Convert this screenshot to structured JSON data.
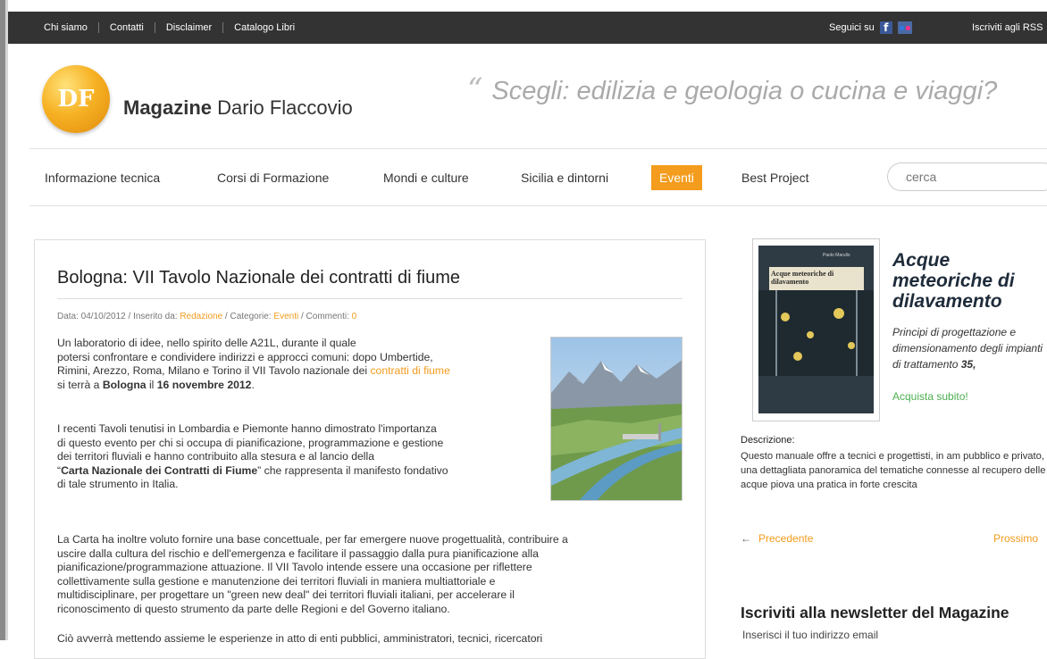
{
  "topbar": {
    "links": [
      "Chi siamo",
      "Contatti",
      "Disclaimer",
      "Catalogo Libri"
    ],
    "follow_label": "Seguici su",
    "rss_label": "Iscriviti agli RSS"
  },
  "header": {
    "logo_text": "DF",
    "title_bold": "Magazine",
    "title_rest": "Dario Flaccovio",
    "tagline": "Scegli: edilizia e geologia o cucina e viaggi?"
  },
  "mainnav": {
    "items": [
      "Informazione tecnica",
      "Corsi di Formazione",
      "Mondi e culture",
      "Sicilia e dintorni",
      "Eventi",
      "Best Project"
    ],
    "active_index": 4,
    "search_placeholder": "cerca"
  },
  "article": {
    "title": "Bologna: VII Tavolo Nazionale dei contratti di fiume",
    "meta": {
      "date_label": "Data: 04/10/2012 / Inserito da:",
      "author": "Redazione",
      "cat_label": "/ Categorie:",
      "category": "Eventi",
      "comments_label": "/ Commenti:",
      "comments": "0"
    },
    "p1": {
      "l1": "Un laboratorio di idee, nello spirito delle A21L, durante il quale",
      "l2": "potersi confrontare e condividere indirizzi e approcci comuni: dopo Umbertide,",
      "l3a": "Rimini, Arezzo, Roma, Milano e Torino il VII Tavolo nazionale dei",
      "l3link": "contratti di fiume",
      "l4a": "si terrà a",
      "l4b": "Bologna",
      "l4c": "il",
      "l4d": "16 novembre 2012",
      "l4e": "."
    },
    "p2": {
      "l1": "I recenti Tavoli tenutisi in Lombardia e Piemonte hanno dimostrato l'importanza",
      "l2": "di questo evento per chi si occupa di pianificazione, programmazione e gestione",
      "l3": "dei territori fluviali e hanno contribuito alla stesura e al lancio della",
      "l4a": "“",
      "l4b": "Carta Nazionale dei Contratti di Fiume",
      "l4c": "” che rappresenta il manifesto fondativo",
      "l5": "di tale strumento in Italia."
    },
    "p3": {
      "l1": "La Carta ha inoltre voluto fornire una base concettuale, per far emergere nuove progettualità, contribuire a",
      "l2": "uscire dalla cultura del rischio e dell'emergenza e facilitare il passaggio dalla pura pianificazione alla",
      "l3": "pianificazione/programmazione attuazione. Il VII Tavolo intende essere una occasione per riflettere",
      "l4": "collettivamente sulla gestione e manutenzione dei territori fluviali in maniera multiattoriale e",
      "l5": "multidisciplinare, per progettare un \"green new deal\" dei territori fluviali italiani, per accelerare il",
      "l6": "riconoscimento di questo strumento da parte delle Regioni e del Governo italiano."
    },
    "p4": {
      "l1": "Ciò avverrà mettendo assieme le esperienze in atto di enti pubblici, amministratori, tecnici, ricercatori"
    }
  },
  "sidebar": {
    "book": {
      "cover_title": "Acque meteoriche di dilavamento",
      "cover_author": "Paolo Marullo",
      "title": "Acque meteoriche di dilavamento",
      "desc": "Principi di progettazione e dimensionamento degli impianti di trattamento",
      "price": "35,",
      "cta": "Acquista subito!"
    },
    "descr_label": "Descrizione:",
    "descr_text": "Questo manuale offre a tecnici e progettisti, in am pubblico e privato, una dettagliata panoramica del tematiche connesse al recupero delle acque piova una pratica in forte crescita",
    "prev_label": "Precedente",
    "next_label": "Prossimo",
    "newsletter_title": "Iscriviti alla newsletter del Magazine",
    "newsletter_sub": "Inserisci il tuo indirizzo email"
  },
  "colors": {
    "accent": "#f39c1d",
    "topbar": "#333333",
    "cta_green": "#4caf50"
  }
}
